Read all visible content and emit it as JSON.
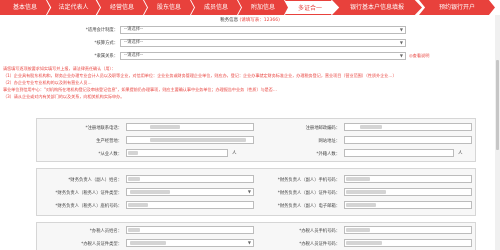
{
  "tabs": [
    {
      "label": "基本信息",
      "active": false
    },
    {
      "label": "法定代表人",
      "active": false
    },
    {
      "label": "经营信息",
      "active": false
    },
    {
      "label": "股东信息",
      "active": false
    },
    {
      "label": "成员信息",
      "active": false
    },
    {
      "label": "附加信息",
      "active": false
    },
    {
      "label": "多证合一",
      "active": true
    },
    {
      "label": "银行基本户信息填报",
      "active": false
    },
    {
      "label": "预约银行开户",
      "active": false
    }
  ],
  "notice": {
    "text": "税务信息",
    "required_hint": "(请填写表：12366)"
  },
  "top_form": {
    "fields": [
      {
        "label": "*适用会计制度：",
        "placeholder": "--请选择--"
      },
      {
        "label": "*核算方式：",
        "placeholder": "--请选择--"
      },
      {
        "label": "*隶属关系：",
        "placeholder": "--请选择--"
      }
    ],
    "hint": "◎查看说明"
  },
  "help_lines": [
    "请您填写逐项按要求如实填写并上报，请法律责任确认（用）：",
    "（1）企业具有股东机构和，财务企业办理专业会计人员以及职等企业，对信用单位：企业业务或财务管理企业单位，则应办，登记：企业办事就定财务标准企业，办理税务登记，营业项目（营业范围）（性质外企业…）",
    "（2）办企业专业专业机构的以及则有营业人员…",
    "事业单位到信用中心：\"对机构所在地机构登记及审核登记信息\"，如果提前仍办理事项，则应主要确认事中业务单位；办理报告中业务（性质）与是否…",
    "（3）请从企业或对内有关部门的以及关系，向相关机构实际申办。"
  ],
  "detail_form": {
    "rows1": [
      {
        "left_label": "*注册地联系电话：",
        "right_label": "注册地邮政编码："
      },
      {
        "left_label": "生产经营地：",
        "right_label": "网站地址："
      },
      {
        "left_label": "*从业人数：",
        "left_unit": "人",
        "right_label": "*外籍人数：",
        "right_unit": "人"
      }
    ],
    "rows2": [
      {
        "left_label": "*财务负责人（副人）姓名：",
        "right_label": "*财务负责人（副人）手机号码："
      },
      {
        "left_label": "*财务负责人（税务人）证件类型：",
        "right_label": "*财务负责人（副人）证件号码："
      },
      {
        "left_label": "*财务负责人（税务人）座机号码：",
        "right_label": "*财务负责人（副人）电子邮箱："
      }
    ],
    "rows3": [
      {
        "left_label": "*办税人员姓名：",
        "right_label": "*办税人员手机号码："
      },
      {
        "left_label": "*办税人员证件类型：",
        "right_label": "*办税人员证件号码："
      }
    ]
  },
  "colors": {
    "accent": "#e8413c",
    "panel_bg": "#f7f7f7",
    "border": "#bcbcbc"
  }
}
